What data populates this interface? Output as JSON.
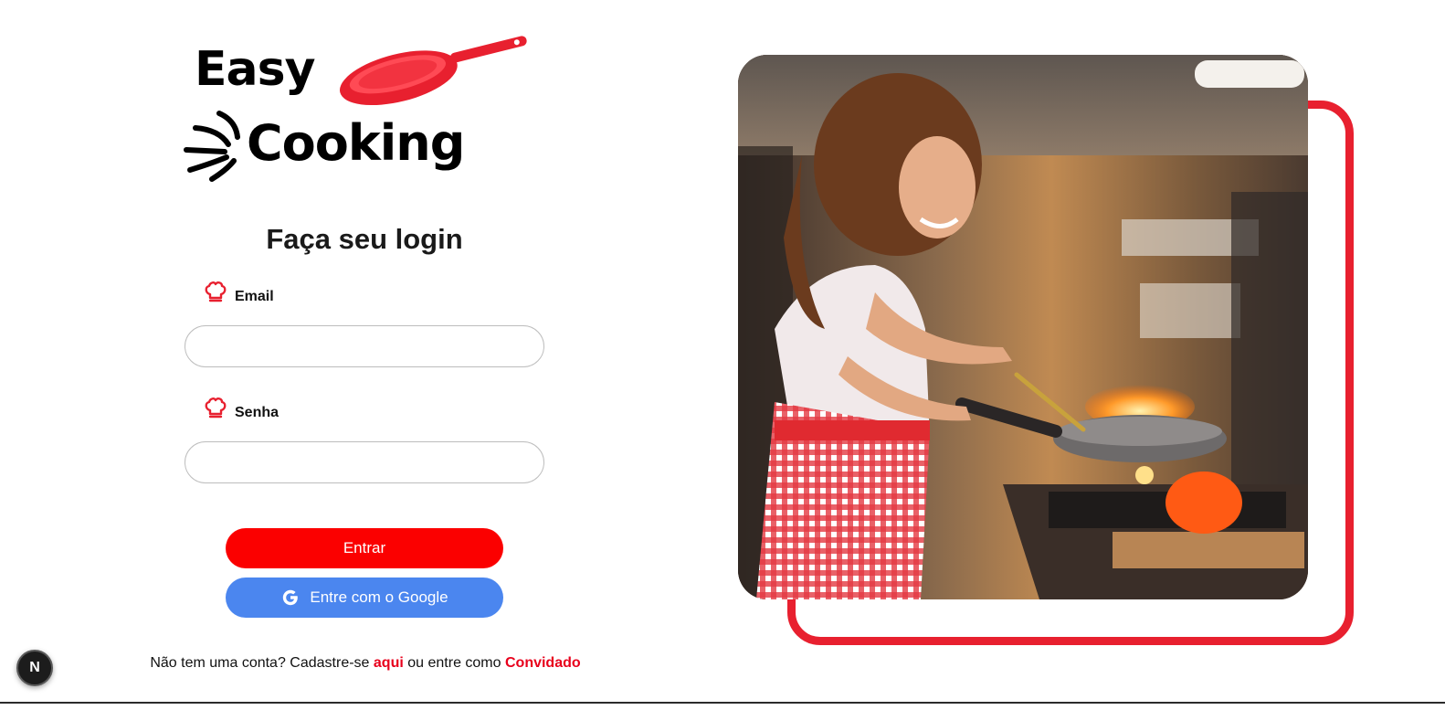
{
  "logo": {
    "line1": "Easy",
    "line2": "Cooking",
    "pan_icon": "frying-pan-icon",
    "swoosh_icon": "motion-lines-icon"
  },
  "login": {
    "title": "Faça seu login",
    "email_label": "Email",
    "email_value": "",
    "password_label": "Senha",
    "password_value": "",
    "field_icon": "chef-hat-icon",
    "submit_label": "Entrar",
    "google_label": "Entre com o Google",
    "google_icon": "google-g-icon"
  },
  "footer_text": {
    "prefix": "Não tem uma conta? Cadastre-se",
    "signup_link": "aqui",
    "middle": "ou entre como",
    "guest_link": "Convidado"
  },
  "next_badge": {
    "letter": "N"
  },
  "colors": {
    "brand_red": "#e8202f",
    "button_red": "#fb0000",
    "google_blue": "#4b86ef",
    "link_red": "#e8001c"
  },
  "hero_image": {
    "description_icon": "woman-cooking-photo"
  }
}
